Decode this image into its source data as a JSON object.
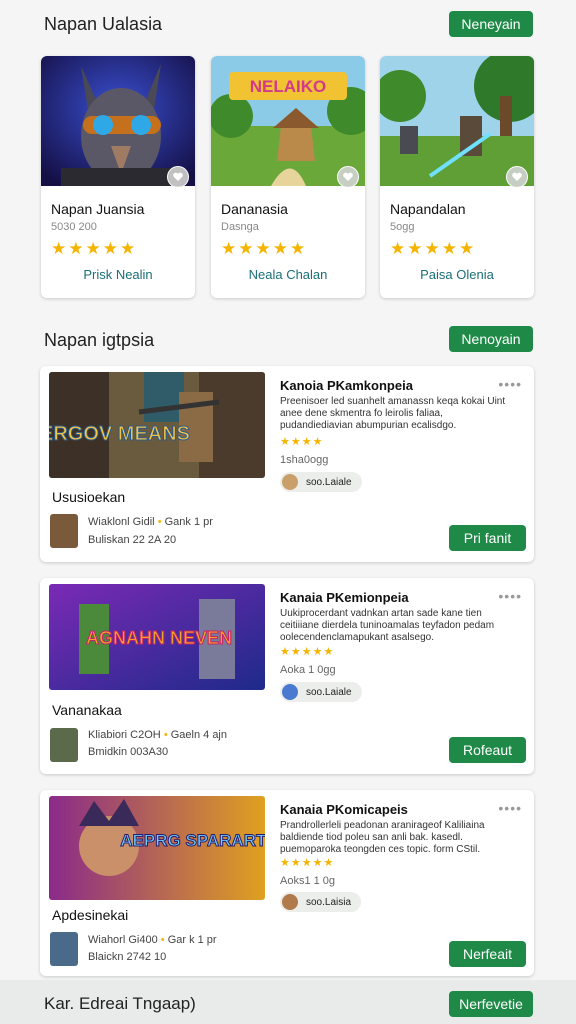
{
  "section1": {
    "title": "Napan Ualasia",
    "button": "Neneyain"
  },
  "cards": [
    {
      "name": "Napan Juansia",
      "sub": "5030 200",
      "stars": "★★★★★",
      "link": "Prisk Nealin",
      "art_text": ""
    },
    {
      "name": "Dananasia",
      "sub": "Dasnga",
      "stars": "★★★★★",
      "link": "Neala Chalan",
      "art_text": "NELAIKO"
    },
    {
      "name": "Napandalan",
      "sub": "5ogg",
      "stars": "★★★★★",
      "link": "Paisa Olenia",
      "art_text": ""
    }
  ],
  "section2": {
    "title": "Napan igtpsia",
    "button": "Nenoyain"
  },
  "items": [
    {
      "art_text": "ERGOV MEANS",
      "title": "Kanoia PKamkonpeia",
      "desc": "Preenisoer led suanhelt amanassn keqa kokai Uint anee dene skmentra fo leirolis faliaa, pudandiediavian abumpurian ecalisdgo.",
      "stars": "★★★★",
      "meta": "1sha0ogg",
      "pill": "soo.Laiale",
      "name": "Ususioekan",
      "author": "Wiaklonl Gidil",
      "author_tag": "Gank 1 pr",
      "date": "Buliskan  22 2A 20",
      "button": "Pri fanit"
    },
    {
      "art_text": "AGNAHN NEVEN",
      "title": "Kanaia PKemionpeia",
      "desc": "Uukiprocerdant vadnkan artan sade kane tien ceitiiiane dierdela tuninoamalas teyfadon pedam oolecendenclamapukant asalsego.",
      "stars": "★★★★★",
      "meta": "Aoka 1 0gg",
      "pill": "soo.Laiale",
      "name": "Vananakaa",
      "author": "Kliabiori C2OH",
      "author_tag": "Gaeln 4 ajn",
      "date": "Bmidkin  003A30",
      "button": "Rofeaut"
    },
    {
      "art_text": "AEPRG SPARARTS",
      "title": "Kanaia PKomicapeis",
      "desc": "Prandrollerleli peadonan aranirageof Kaliliaina baldiende tiod poleu san anli bak. kasedl. puemoparoka teongden ces topic. form CStil.",
      "stars": "★★★★★",
      "meta": "Aoks1 1 0g",
      "pill": "soo.Laisia",
      "name": "Apdesinekai",
      "author": "Wiahorl Gi400",
      "author_tag": "Gar k 1 pr",
      "date": "Blaickn 2742 10",
      "button": "Nerfeait"
    }
  ],
  "bottom": {
    "label": "Kar. Edreai Tngaap)",
    "button": "Nerfevetie"
  },
  "colors": {
    "accent": "#1f8a47",
    "link": "#1b6f77",
    "star": "#f4b400"
  }
}
